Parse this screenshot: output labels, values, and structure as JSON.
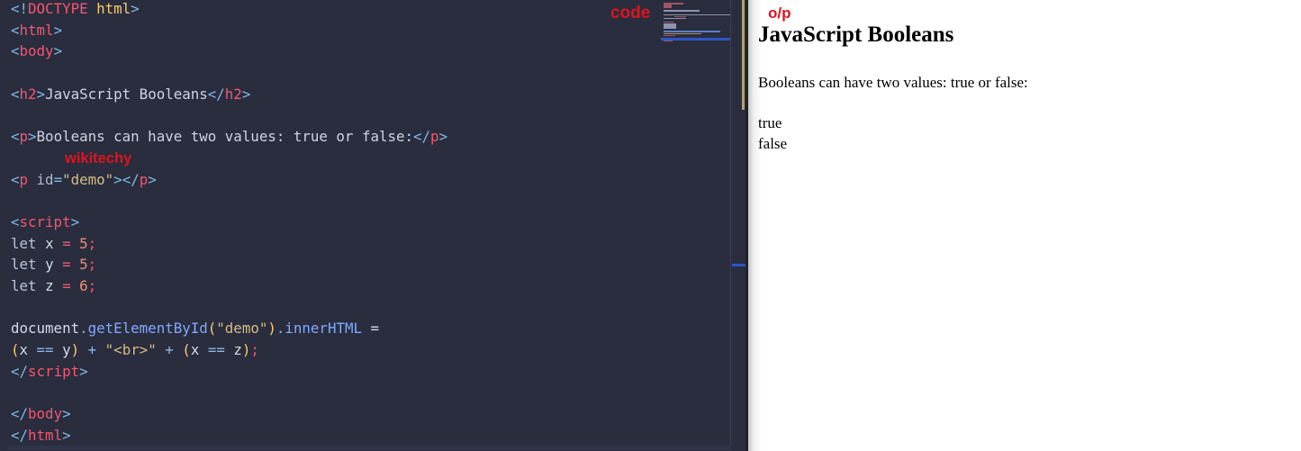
{
  "colors": {
    "editor_background": "#292d3e",
    "annotation_red": "#e0131d",
    "indicator_blue": "#2e55c8",
    "tan_marker": "#b3a26d",
    "tag_red": "#f4566f",
    "string_khaki": "#d6bc85",
    "function_blue": "#82aaff",
    "number_orange": "#f78c6c",
    "paren_yellow": "#ffcb6b"
  },
  "editor": {
    "annotation_label": "code",
    "watermark_text": "wikitechy",
    "lines": [
      {
        "tokens": [
          [
            "<!",
            "pu"
          ],
          [
            "DOCTYPE",
            "tg"
          ],
          [
            " ",
            "pl"
          ],
          [
            "html",
            "or"
          ],
          [
            ">",
            "pu"
          ]
        ]
      },
      {
        "tokens": [
          [
            "<",
            "pu"
          ],
          [
            "html",
            "tg"
          ],
          [
            ">",
            "pu"
          ]
        ]
      },
      {
        "tokens": [
          [
            "<",
            "pu"
          ],
          [
            "body",
            "tg"
          ],
          [
            ">",
            "pu"
          ]
        ]
      },
      {
        "tokens": []
      },
      {
        "tokens": [
          [
            "<",
            "pu"
          ],
          [
            "h2",
            "tg"
          ],
          [
            ">",
            "pu"
          ],
          [
            "JavaScript Booleans",
            "tx"
          ],
          [
            "</",
            "pu"
          ],
          [
            "h2",
            "tg"
          ],
          [
            ">",
            "pu"
          ]
        ]
      },
      {
        "tokens": []
      },
      {
        "tokens": [
          [
            "<",
            "pu"
          ],
          [
            "p",
            "tg"
          ],
          [
            ">",
            "pu"
          ],
          [
            "Booleans can have two values: true or false:",
            "tx"
          ],
          [
            "</",
            "pu"
          ],
          [
            "p",
            "tg"
          ],
          [
            ">",
            "pu"
          ]
        ]
      },
      {
        "watermark": "wikitechy"
      },
      {
        "tokens": [
          [
            "<",
            "pu"
          ],
          [
            "p",
            "tg"
          ],
          [
            " ",
            "pl"
          ],
          [
            "id",
            "at"
          ],
          [
            "=",
            "pu"
          ],
          [
            "\"demo\"",
            "st"
          ],
          [
            ">",
            "pu"
          ],
          [
            "</",
            "pu"
          ],
          [
            "p",
            "tg"
          ],
          [
            ">",
            "pu"
          ]
        ]
      },
      {
        "tokens": []
      },
      {
        "tokens": [
          [
            "<",
            "pu"
          ],
          [
            "script",
            "tg"
          ],
          [
            ">",
            "pu"
          ]
        ]
      },
      {
        "tokens": [
          [
            "let",
            "kw"
          ],
          [
            " ",
            "pl"
          ],
          [
            "x",
            "vr"
          ],
          [
            " ",
            "pl"
          ],
          [
            "=",
            "as"
          ],
          [
            " ",
            "pl"
          ],
          [
            "5",
            "nu"
          ],
          [
            ";",
            "as"
          ]
        ]
      },
      {
        "tokens": [
          [
            "let",
            "kw"
          ],
          [
            " ",
            "pl"
          ],
          [
            "y",
            "vr"
          ],
          [
            " ",
            "pl"
          ],
          [
            "=",
            "as"
          ],
          [
            " ",
            "pl"
          ],
          [
            "5",
            "nu"
          ],
          [
            ";",
            "as"
          ]
        ]
      },
      {
        "tokens": [
          [
            "let",
            "kw"
          ],
          [
            " ",
            "pl"
          ],
          [
            "z",
            "vr"
          ],
          [
            " ",
            "pl"
          ],
          [
            "=",
            "as"
          ],
          [
            " ",
            "pl"
          ],
          [
            "6",
            "nu"
          ],
          [
            ";",
            "as"
          ]
        ]
      },
      {
        "tokens": []
      },
      {
        "tokens": [
          [
            "document",
            "vr"
          ],
          [
            ".",
            "pu"
          ],
          [
            "getElementById",
            "fn"
          ],
          [
            "(",
            "or"
          ],
          [
            "\"demo\"",
            "st"
          ],
          [
            ")",
            "or"
          ],
          [
            ".",
            "pu"
          ],
          [
            "innerHTML",
            "fn"
          ],
          [
            " ",
            "pl"
          ],
          [
            "=",
            "vr"
          ]
        ]
      },
      {
        "tokens": [
          [
            "(",
            "or"
          ],
          [
            "x",
            "vr"
          ],
          [
            " ",
            "pl"
          ],
          [
            "==",
            "op"
          ],
          [
            " ",
            "pl"
          ],
          [
            "y",
            "vr"
          ],
          [
            ")",
            "or"
          ],
          [
            " ",
            "pl"
          ],
          [
            "+",
            "op"
          ],
          [
            " ",
            "pl"
          ],
          [
            "\"<br>\"",
            "st"
          ],
          [
            " ",
            "pl"
          ],
          [
            "+",
            "op"
          ],
          [
            " ",
            "pl"
          ],
          [
            "(",
            "or"
          ],
          [
            "x",
            "vr"
          ],
          [
            " ",
            "pl"
          ],
          [
            "==",
            "op"
          ],
          [
            " ",
            "pl"
          ],
          [
            "z",
            "vr"
          ],
          [
            ")",
            "or"
          ],
          [
            ";",
            "as"
          ]
        ]
      },
      {
        "tokens": [
          [
            "</",
            "pu"
          ],
          [
            "script",
            "tg"
          ],
          [
            ">",
            "pu"
          ]
        ]
      },
      {
        "tokens": []
      },
      {
        "tokens": [
          [
            "</",
            "pu"
          ],
          [
            "body",
            "tg"
          ],
          [
            ">",
            "pu"
          ]
        ]
      },
      {
        "tokens": [
          [
            "</",
            "pu"
          ],
          [
            "html",
            "tg"
          ],
          [
            ">",
            "pu"
          ]
        ]
      }
    ],
    "minimap": {
      "palette": {
        "r": "#a05468",
        "g": "#8e94aa",
        "b": "#5c7fd0",
        "y": "#a8905e"
      },
      "rows": [
        [
          22,
          "r",
          0
        ],
        [
          9,
          "r",
          0
        ],
        [
          9,
          "r",
          0
        ],
        [
          0,
          "",
          0
        ],
        [
          40,
          "g",
          0
        ],
        [
          0,
          "",
          0
        ],
        [
          75,
          "g",
          0
        ],
        [
          13,
          "r",
          12
        ],
        [
          25,
          "g",
          0
        ],
        [
          0,
          "",
          0
        ],
        [
          12,
          "r",
          0
        ],
        [
          14,
          "g",
          0
        ],
        [
          14,
          "g",
          0
        ],
        [
          14,
          "g",
          0
        ],
        [
          0,
          "",
          0
        ],
        [
          63,
          "b",
          0
        ],
        [
          42,
          "y",
          0
        ],
        [
          13,
          "r",
          0
        ],
        [
          0,
          "",
          0
        ],
        [
          10,
          "r",
          0
        ],
        [
          10,
          "r",
          0
        ]
      ]
    }
  },
  "output": {
    "annotation_label": "o/p",
    "heading": "JavaScript Booleans",
    "paragraph": "Booleans can have two values: true or false:",
    "result_lines": [
      "true",
      "false"
    ]
  }
}
